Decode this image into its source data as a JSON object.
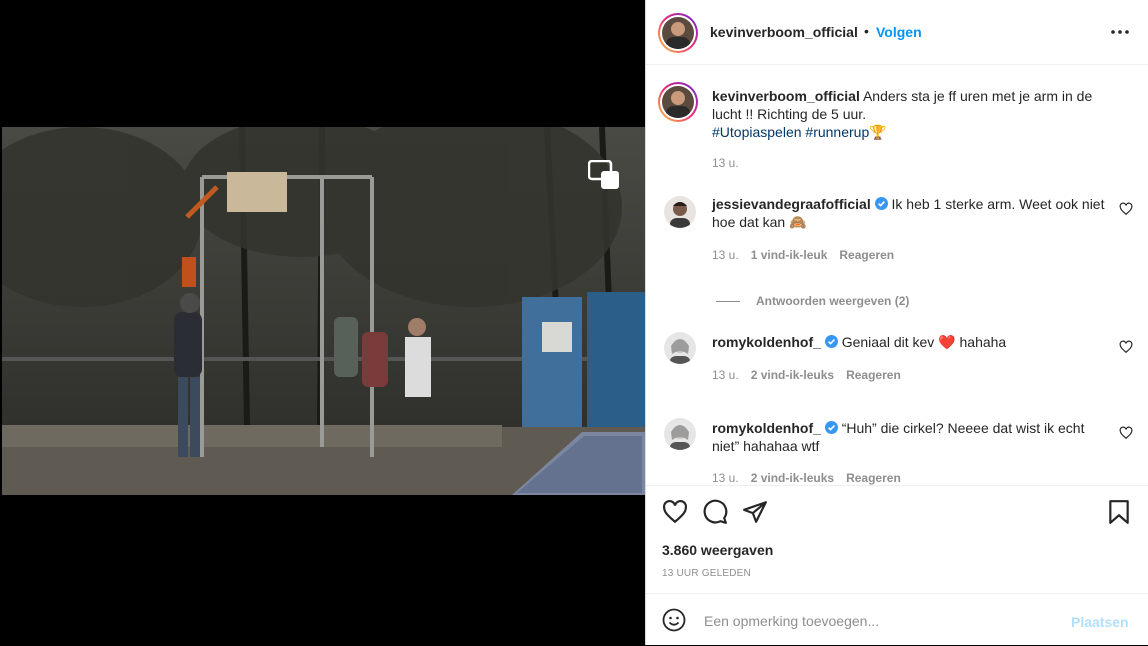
{
  "header": {
    "username": "kevinverboom_official",
    "separator": "•",
    "follow_label": "Volgen"
  },
  "caption": {
    "username": "kevinverboom_official",
    "text": "Anders sta je ff uren met je arm in de lucht !! Richting de 5 uur.",
    "hashtags": [
      "#Utopiaspelen",
      "#runnerup"
    ],
    "trophy": "🏆",
    "time": "13 u."
  },
  "comments": [
    {
      "username": "jessievandegraafofficial",
      "text": "Ik heb 1 sterke arm. Weet ook niet hoe dat kan 🙈",
      "time": "13 u.",
      "likes": "1 vind-ik-leuk",
      "reply_label": "Reageren",
      "verified": true
    },
    {
      "username": "romykoldenhof_",
      "text": "Geniaal dit kev ❤️ hahaha",
      "time": "13 u.",
      "likes": "2 vind-ik-leuks",
      "reply_label": "Reageren",
      "verified": true
    },
    {
      "username": "romykoldenhof_",
      "text": "“Huh” die cirkel? Neeee dat wist ik echt niet” hahahaa wtf",
      "time": "13 u.",
      "likes": "2 vind-ik-leuks",
      "reply_label": "Reageren",
      "verified": true
    }
  ],
  "replies_toggle": "Antwoorden weergeven (2)",
  "stats": {
    "views": "3.860 weergaven",
    "posted": "13 uur geleden"
  },
  "add_comment": {
    "placeholder": "Een opmerking toevoegen...",
    "post_label": "Plaatsen"
  },
  "colors": {
    "accent": "#0095f6",
    "hashtag": "#00376b",
    "verified": "#3897f0",
    "muted": "#8e8e8e"
  },
  "icons": [
    "more-icon",
    "pip-icon",
    "heart-icon",
    "comment-icon",
    "share-icon",
    "bookmark-icon",
    "emoji-icon",
    "verified-icon"
  ]
}
